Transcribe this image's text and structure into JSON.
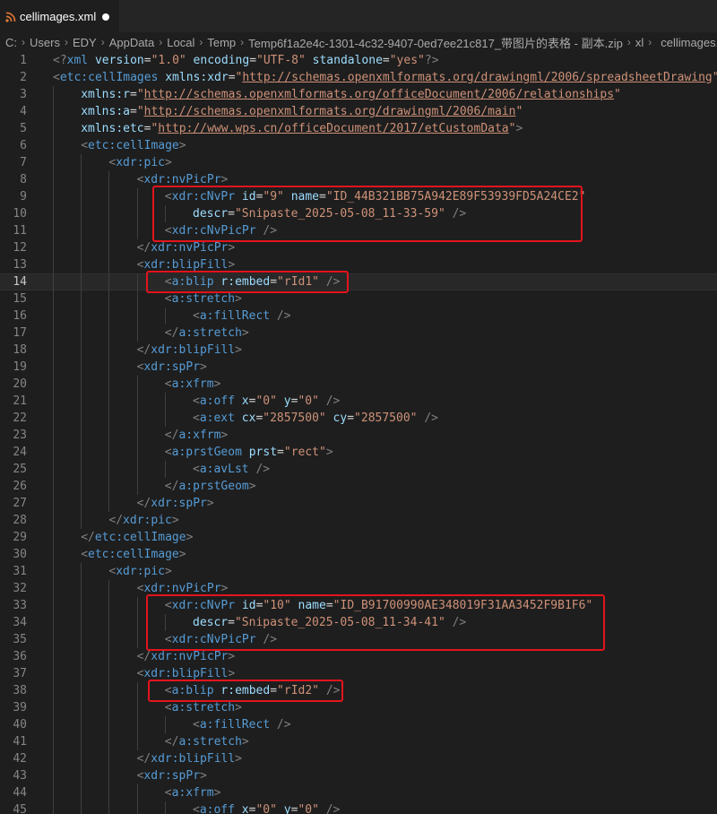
{
  "tab": {
    "filename": "cellimages.xml",
    "icon": "rss-feed-icon",
    "dirty": true,
    "accent": "#e37933"
  },
  "breadcrumb": [
    "C:",
    "Users",
    "EDY",
    "AppData",
    "Local",
    "Temp",
    "Temp6f1a2e4c-1301-4c32-9407-0ed7ee21c817_带图片的表格 - 副本.zip",
    "xl",
    "cellimages.xml"
  ],
  "editor": {
    "active_line": 14,
    "lines": [
      {
        "n": "1",
        "indent": 0,
        "t": [
          [
            "p",
            "<?"
          ],
          [
            "g",
            "xml"
          ],
          [
            "a",
            " version"
          ],
          [
            "e",
            "="
          ],
          [
            "v",
            "\"1.0\""
          ],
          [
            "a",
            " encoding"
          ],
          [
            "e",
            "="
          ],
          [
            "v",
            "\"UTF-8\""
          ],
          [
            "a",
            " standalone"
          ],
          [
            "e",
            "="
          ],
          [
            "v",
            "\"yes\""
          ],
          [
            "p",
            "?>"
          ]
        ]
      },
      {
        "n": "2",
        "indent": 0,
        "t": [
          [
            "p",
            "<"
          ],
          [
            "g",
            "etc:cellImages"
          ],
          [
            "a",
            " xmlns:xdr"
          ],
          [
            "e",
            "="
          ],
          [
            "v",
            "\""
          ],
          [
            "u",
            "http://schemas.openxmlformats.org/drawingml/2006/spreadsheetDrawing"
          ],
          [
            "v",
            "\""
          ]
        ]
      },
      {
        "n": "3",
        "indent": 1,
        "t": [
          [
            "a",
            "xmlns:r"
          ],
          [
            "e",
            "="
          ],
          [
            "v",
            "\""
          ],
          [
            "u",
            "http://schemas.openxmlformats.org/officeDocument/2006/relationships"
          ],
          [
            "v",
            "\""
          ]
        ]
      },
      {
        "n": "4",
        "indent": 1,
        "t": [
          [
            "a",
            "xmlns:a"
          ],
          [
            "e",
            "="
          ],
          [
            "v",
            "\""
          ],
          [
            "u",
            "http://schemas.openxmlformats.org/drawingml/2006/main"
          ],
          [
            "v",
            "\""
          ]
        ]
      },
      {
        "n": "5",
        "indent": 1,
        "t": [
          [
            "a",
            "xmlns:etc"
          ],
          [
            "e",
            "="
          ],
          [
            "v",
            "\""
          ],
          [
            "u",
            "http://www.wps.cn/officeDocument/2017/etCustomData"
          ],
          [
            "v",
            "\""
          ],
          [
            "p",
            ">"
          ]
        ]
      },
      {
        "n": "6",
        "indent": 1,
        "t": [
          [
            "p",
            "<"
          ],
          [
            "g",
            "etc:cellImage"
          ],
          [
            "p",
            ">"
          ]
        ]
      },
      {
        "n": "7",
        "indent": 2,
        "t": [
          [
            "p",
            "<"
          ],
          [
            "g",
            "xdr:pic"
          ],
          [
            "p",
            ">"
          ]
        ]
      },
      {
        "n": "8",
        "indent": 3,
        "t": [
          [
            "p",
            "<"
          ],
          [
            "g",
            "xdr:nvPicPr"
          ],
          [
            "p",
            ">"
          ]
        ]
      },
      {
        "n": "9",
        "indent": 4,
        "t": [
          [
            "p",
            "<"
          ],
          [
            "g",
            "xdr:cNvPr"
          ],
          [
            "a",
            " id"
          ],
          [
            "e",
            "="
          ],
          [
            "v",
            "\"9\""
          ],
          [
            "a",
            " name"
          ],
          [
            "e",
            "="
          ],
          [
            "v",
            "\"ID_44B321BB75A942E89F53939FD5A24CE2\""
          ]
        ]
      },
      {
        "n": "10",
        "indent": 5,
        "t": [
          [
            "a",
            "descr"
          ],
          [
            "e",
            "="
          ],
          [
            "v",
            "\"Snipaste_2025-05-08_11-33-59\""
          ],
          [
            "p",
            " />"
          ]
        ]
      },
      {
        "n": "11",
        "indent": 4,
        "t": [
          [
            "p",
            "<"
          ],
          [
            "g",
            "xdr:cNvPicPr"
          ],
          [
            "p",
            " />"
          ]
        ]
      },
      {
        "n": "12",
        "indent": 3,
        "t": [
          [
            "p",
            "</"
          ],
          [
            "g",
            "xdr:nvPicPr"
          ],
          [
            "p",
            ">"
          ]
        ]
      },
      {
        "n": "13",
        "indent": 3,
        "t": [
          [
            "p",
            "<"
          ],
          [
            "g",
            "xdr:blipFill"
          ],
          [
            "p",
            ">"
          ]
        ]
      },
      {
        "n": "14",
        "indent": 4,
        "t": [
          [
            "p",
            "<"
          ],
          [
            "g",
            "a:blip"
          ],
          [
            "a",
            " r:embed"
          ],
          [
            "e",
            "="
          ],
          [
            "v",
            "\"rId1\""
          ],
          [
            "p",
            " />"
          ]
        ]
      },
      {
        "n": "15",
        "indent": 4,
        "t": [
          [
            "p",
            "<"
          ],
          [
            "g",
            "a:stretch"
          ],
          [
            "p",
            ">"
          ]
        ]
      },
      {
        "n": "16",
        "indent": 5,
        "t": [
          [
            "p",
            "<"
          ],
          [
            "g",
            "a:fillRect"
          ],
          [
            "p",
            " />"
          ]
        ]
      },
      {
        "n": "17",
        "indent": 4,
        "t": [
          [
            "p",
            "</"
          ],
          [
            "g",
            "a:stretch"
          ],
          [
            "p",
            ">"
          ]
        ]
      },
      {
        "n": "18",
        "indent": 3,
        "t": [
          [
            "p",
            "</"
          ],
          [
            "g",
            "xdr:blipFill"
          ],
          [
            "p",
            ">"
          ]
        ]
      },
      {
        "n": "19",
        "indent": 3,
        "t": [
          [
            "p",
            "<"
          ],
          [
            "g",
            "xdr:spPr"
          ],
          [
            "p",
            ">"
          ]
        ]
      },
      {
        "n": "20",
        "indent": 4,
        "t": [
          [
            "p",
            "<"
          ],
          [
            "g",
            "a:xfrm"
          ],
          [
            "p",
            ">"
          ]
        ]
      },
      {
        "n": "21",
        "indent": 5,
        "t": [
          [
            "p",
            "<"
          ],
          [
            "g",
            "a:off"
          ],
          [
            "a",
            " x"
          ],
          [
            "e",
            "="
          ],
          [
            "v",
            "\"0\""
          ],
          [
            "a",
            " y"
          ],
          [
            "e",
            "="
          ],
          [
            "v",
            "\"0\""
          ],
          [
            "p",
            " />"
          ]
        ]
      },
      {
        "n": "22",
        "indent": 5,
        "t": [
          [
            "p",
            "<"
          ],
          [
            "g",
            "a:ext"
          ],
          [
            "a",
            " cx"
          ],
          [
            "e",
            "="
          ],
          [
            "v",
            "\"2857500\""
          ],
          [
            "a",
            " cy"
          ],
          [
            "e",
            "="
          ],
          [
            "v",
            "\"2857500\""
          ],
          [
            "p",
            " />"
          ]
        ]
      },
      {
        "n": "23",
        "indent": 4,
        "t": [
          [
            "p",
            "</"
          ],
          [
            "g",
            "a:xfrm"
          ],
          [
            "p",
            ">"
          ]
        ]
      },
      {
        "n": "24",
        "indent": 4,
        "t": [
          [
            "p",
            "<"
          ],
          [
            "g",
            "a:prstGeom"
          ],
          [
            "a",
            " prst"
          ],
          [
            "e",
            "="
          ],
          [
            "v",
            "\"rect\""
          ],
          [
            "p",
            ">"
          ]
        ]
      },
      {
        "n": "25",
        "indent": 5,
        "t": [
          [
            "p",
            "<"
          ],
          [
            "g",
            "a:avLst"
          ],
          [
            "p",
            " />"
          ]
        ]
      },
      {
        "n": "26",
        "indent": 4,
        "t": [
          [
            "p",
            "</"
          ],
          [
            "g",
            "a:prstGeom"
          ],
          [
            "p",
            ">"
          ]
        ]
      },
      {
        "n": "27",
        "indent": 3,
        "t": [
          [
            "p",
            "</"
          ],
          [
            "g",
            "xdr:spPr"
          ],
          [
            "p",
            ">"
          ]
        ]
      },
      {
        "n": "28",
        "indent": 2,
        "t": [
          [
            "p",
            "</"
          ],
          [
            "g",
            "xdr:pic"
          ],
          [
            "p",
            ">"
          ]
        ]
      },
      {
        "n": "29",
        "indent": 1,
        "t": [
          [
            "p",
            "</"
          ],
          [
            "g",
            "etc:cellImage"
          ],
          [
            "p",
            ">"
          ]
        ]
      },
      {
        "n": "30",
        "indent": 1,
        "t": [
          [
            "p",
            "<"
          ],
          [
            "g",
            "etc:cellImage"
          ],
          [
            "p",
            ">"
          ]
        ]
      },
      {
        "n": "31",
        "indent": 2,
        "t": [
          [
            "p",
            "<"
          ],
          [
            "g",
            "xdr:pic"
          ],
          [
            "p",
            ">"
          ]
        ]
      },
      {
        "n": "32",
        "indent": 3,
        "t": [
          [
            "p",
            "<"
          ],
          [
            "g",
            "xdr:nvPicPr"
          ],
          [
            "p",
            ">"
          ]
        ]
      },
      {
        "n": "33",
        "indent": 4,
        "t": [
          [
            "p",
            "<"
          ],
          [
            "g",
            "xdr:cNvPr"
          ],
          [
            "a",
            " id"
          ],
          [
            "e",
            "="
          ],
          [
            "v",
            "\"10\""
          ],
          [
            "a",
            " name"
          ],
          [
            "e",
            "="
          ],
          [
            "v",
            "\"ID_B91700990AE348019F31AA3452F9B1F6\""
          ]
        ]
      },
      {
        "n": "34",
        "indent": 5,
        "t": [
          [
            "a",
            "descr"
          ],
          [
            "e",
            "="
          ],
          [
            "v",
            "\"Snipaste_2025-05-08_11-34-41\""
          ],
          [
            "p",
            " />"
          ]
        ]
      },
      {
        "n": "35",
        "indent": 4,
        "t": [
          [
            "p",
            "<"
          ],
          [
            "g",
            "xdr:cNvPicPr"
          ],
          [
            "p",
            " />"
          ]
        ]
      },
      {
        "n": "36",
        "indent": 3,
        "t": [
          [
            "p",
            "</"
          ],
          [
            "g",
            "xdr:nvPicPr"
          ],
          [
            "p",
            ">"
          ]
        ]
      },
      {
        "n": "37",
        "indent": 3,
        "t": [
          [
            "p",
            "<"
          ],
          [
            "g",
            "xdr:blipFill"
          ],
          [
            "p",
            ">"
          ]
        ]
      },
      {
        "n": "38",
        "indent": 4,
        "t": [
          [
            "p",
            "<"
          ],
          [
            "g",
            "a:blip"
          ],
          [
            "a",
            " r:embed"
          ],
          [
            "e",
            "="
          ],
          [
            "v",
            "\"rId2\""
          ],
          [
            "p",
            " />"
          ]
        ]
      },
      {
        "n": "39",
        "indent": 4,
        "t": [
          [
            "p",
            "<"
          ],
          [
            "g",
            "a:stretch"
          ],
          [
            "p",
            ">"
          ]
        ]
      },
      {
        "n": "40",
        "indent": 5,
        "t": [
          [
            "p",
            "<"
          ],
          [
            "g",
            "a:fillRect"
          ],
          [
            "p",
            " />"
          ]
        ]
      },
      {
        "n": "41",
        "indent": 4,
        "t": [
          [
            "p",
            "</"
          ],
          [
            "g",
            "a:stretch"
          ],
          [
            "p",
            ">"
          ]
        ]
      },
      {
        "n": "42",
        "indent": 3,
        "t": [
          [
            "p",
            "</"
          ],
          [
            "g",
            "xdr:blipFill"
          ],
          [
            "p",
            ">"
          ]
        ]
      },
      {
        "n": "43",
        "indent": 3,
        "t": [
          [
            "p",
            "<"
          ],
          [
            "g",
            "xdr:spPr"
          ],
          [
            "p",
            ">"
          ]
        ]
      },
      {
        "n": "44",
        "indent": 4,
        "t": [
          [
            "p",
            "<"
          ],
          [
            "g",
            "a:xfrm"
          ],
          [
            "p",
            ">"
          ]
        ]
      },
      {
        "n": "45",
        "indent": 5,
        "t": [
          [
            "p",
            "<"
          ],
          [
            "g",
            "a:off"
          ],
          [
            "a",
            " x"
          ],
          [
            "e",
            "="
          ],
          [
            "v",
            "\"0\""
          ],
          [
            "a",
            " y"
          ],
          [
            "e",
            "="
          ],
          [
            "v",
            "\"0\""
          ],
          [
            "p",
            " />"
          ]
        ]
      }
    ]
  },
  "highlights": [
    {
      "label": "cnvpr-9-box",
      "lines": [
        9,
        11
      ]
    },
    {
      "label": "blip-rid1-box",
      "lines": [
        14,
        14
      ]
    },
    {
      "label": "cnvpr-10-box",
      "lines": [
        33,
        35
      ]
    },
    {
      "label": "blip-rid2-box",
      "lines": [
        38,
        38
      ]
    }
  ],
  "colors": {
    "background": "#1e1e1e",
    "tag": "#569cd6",
    "attribute": "#9cdcfe",
    "string": "#ce9178",
    "punctuation": "#808080",
    "highlight_box": "#e3141d"
  }
}
